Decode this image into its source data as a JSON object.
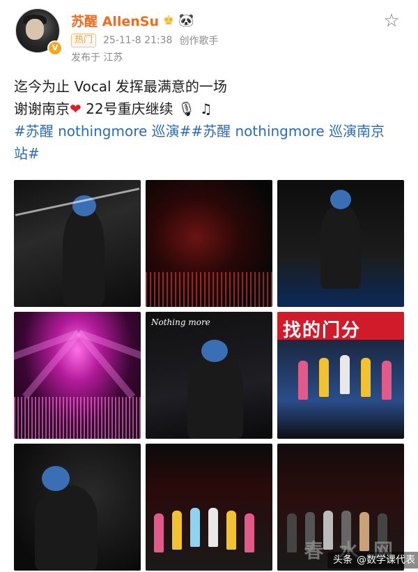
{
  "post": {
    "author_name": "苏醒 AllenSu",
    "hot_label": "热门",
    "timestamp": "25-11-8 21:38",
    "author_role": "创作歌手",
    "location": "发布于 江苏",
    "text_line1": "迄今为止 Vocal 发挥最满意的一场",
    "text_line2_a": "谢谢南京",
    "text_line2_b": "22号重庆继续",
    "hashtag_line1": "#苏醒 nothingmore 巡演##苏醒 nothingmore 巡演南京",
    "hashtag_line2": "站#"
  },
  "photos": {
    "p6_banner": "找的门分",
    "p5_logo": "Nothing more"
  },
  "watermark": {
    "site": "春 水 网",
    "source_prefix": "头条",
    "source_name": "@数学课代表"
  },
  "icons": {
    "verified": "verified-v-icon",
    "crown": "crown-icon",
    "panda": "panda-icon",
    "heart": "heart-icon",
    "microphone": "microphone-icon",
    "music": "music-note-icon",
    "follow": "star-outline-icon"
  },
  "colors": {
    "author_name": "#f26b1d",
    "hashtag": "#2b6bb5",
    "meta": "#8a8a8a",
    "heart": "#e11d2a"
  }
}
